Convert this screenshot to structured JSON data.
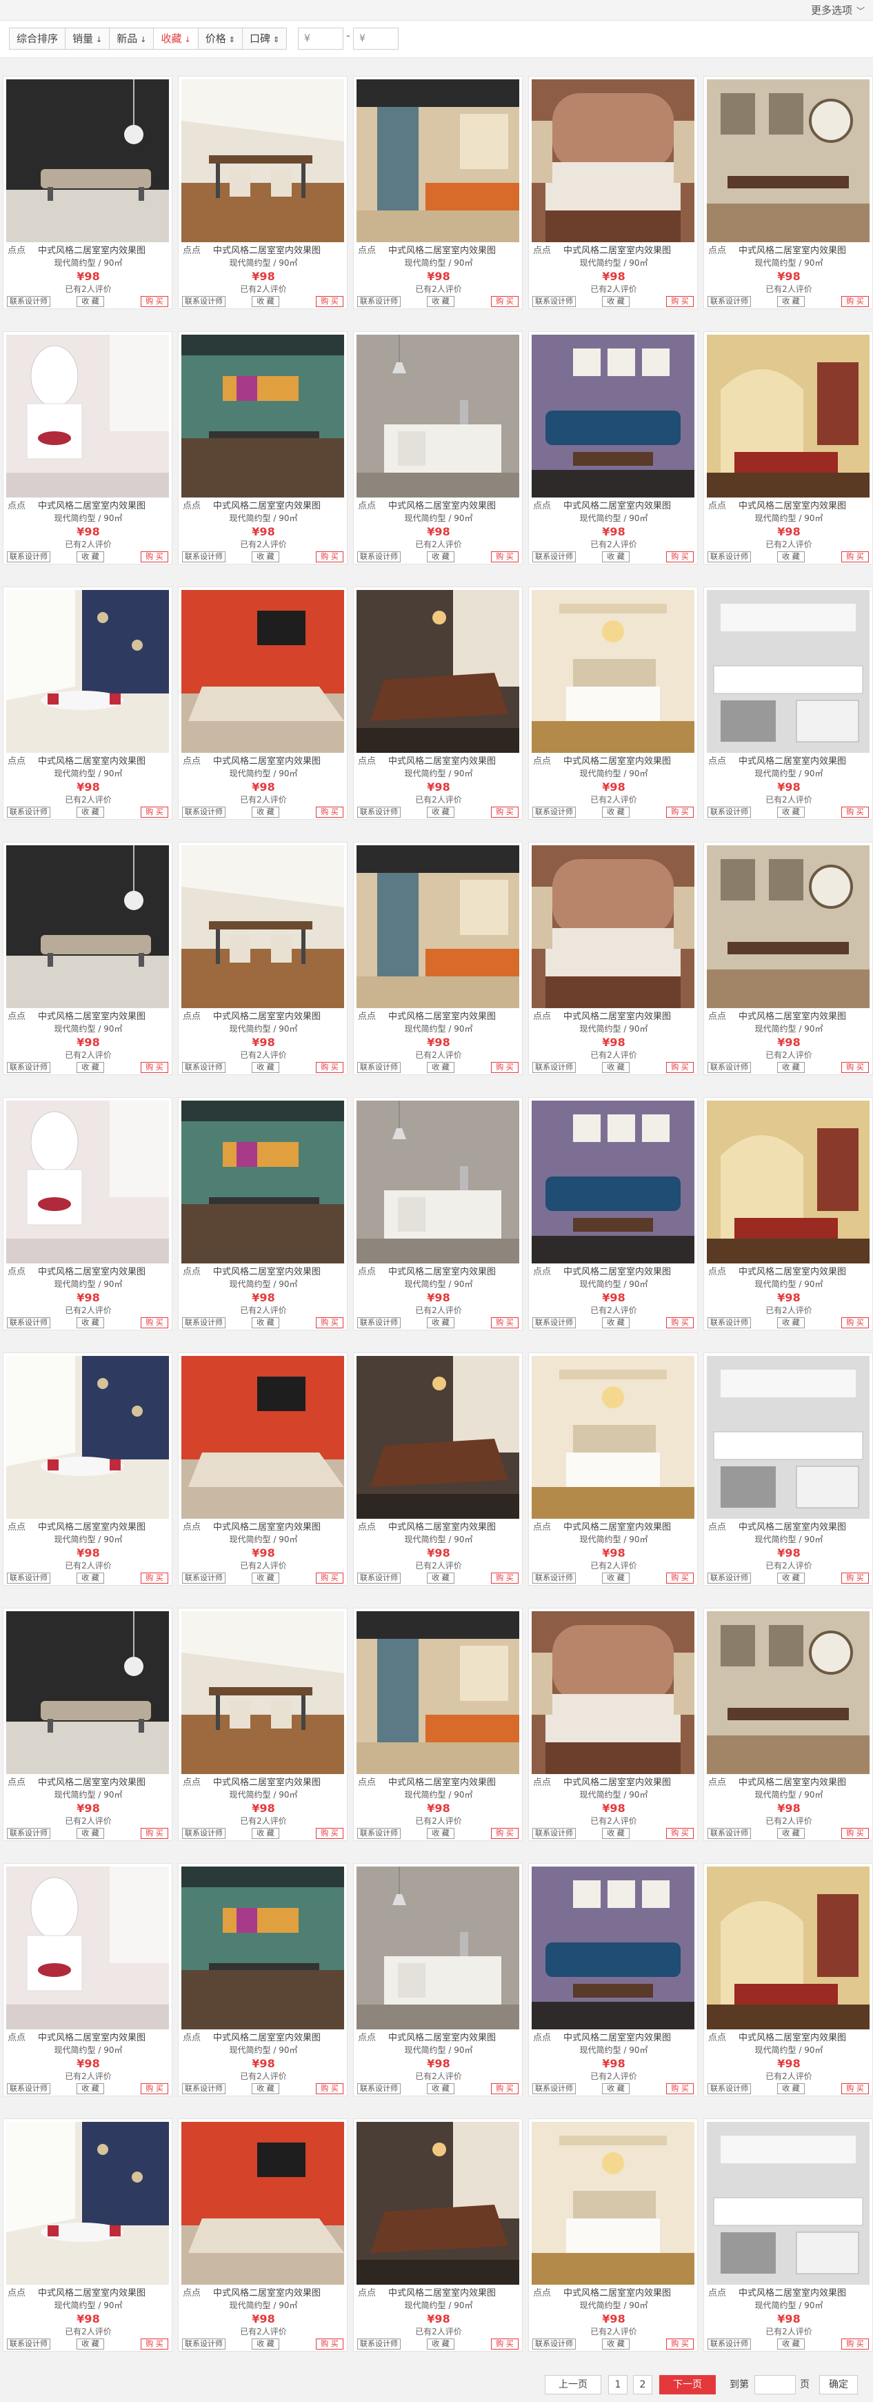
{
  "topbar": {
    "more_options": "更多选项"
  },
  "filters": {
    "sort": [
      "综合排序",
      "销量",
      "新品",
      "收藏",
      "价格",
      "口碑"
    ],
    "active_index": 3,
    "price_from": "¥",
    "price_to": "¥",
    "price_sep": "-"
  },
  "product_common": {
    "shop": "点点",
    "title": "中式风格二居室室内效果图",
    "spec": "现代简约型 / 90㎡",
    "price": "¥98",
    "reviews": "已有2人评价",
    "designer_btn": "联系设计师",
    "fav_btn": "收 藏",
    "buy_btn": "购 买"
  },
  "pagination": {
    "prev": "上一页",
    "pages": [
      "1",
      "2"
    ],
    "next": "下一页",
    "goto": "到第",
    "page_unit": "页",
    "confirm": "确定"
  }
}
